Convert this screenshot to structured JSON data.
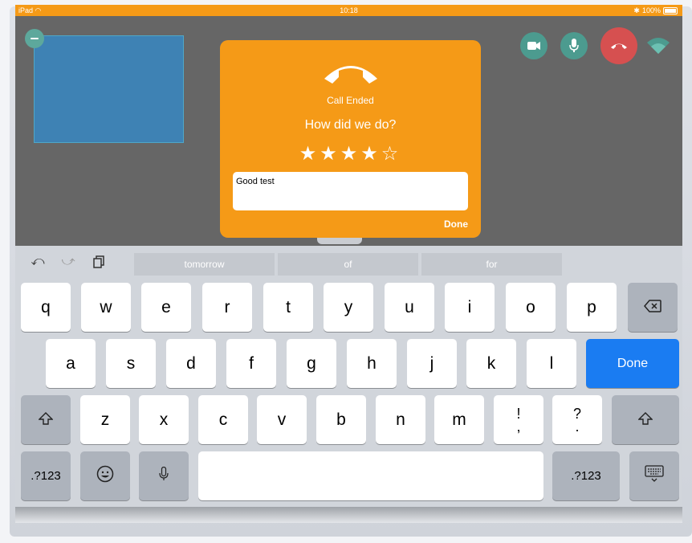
{
  "status_bar": {
    "left": "iPad",
    "time": "10:18",
    "battery": "100%"
  },
  "dialog": {
    "status": "Call Ended",
    "prompt": "How did we do?",
    "rating": 4,
    "rating_max": 5,
    "stars": "★★★★☆",
    "feedback": "Good test",
    "done": "Done"
  },
  "keyboard": {
    "suggestions": [
      "tomorrow",
      "of",
      "for"
    ],
    "row1": [
      "q",
      "w",
      "e",
      "r",
      "t",
      "y",
      "u",
      "i",
      "o",
      "p"
    ],
    "row2": [
      "a",
      "s",
      "d",
      "f",
      "g",
      "h",
      "j",
      "k",
      "l"
    ],
    "row3": [
      "z",
      "x",
      "c",
      "v",
      "b",
      "n",
      "m"
    ],
    "punct1": {
      "top": "!",
      "bottom": ","
    },
    "punct2": {
      "top": "?",
      "bottom": "."
    },
    "done": "Done",
    "numbers_left": ".?123",
    "numbers_right": ".?123"
  },
  "colors": {
    "accent": "#f59a17",
    "call_control": "#4c9b8f",
    "hangup": "#d65050",
    "keyboard_done": "#1a7cf2"
  },
  "icons": [
    "minimize-icon",
    "video-camera-icon",
    "microphone-icon",
    "hang-up-icon",
    "wifi-icon",
    "phone-handset-icon",
    "undo-icon",
    "redo-icon",
    "paste-icon",
    "backspace-icon",
    "shift-icon",
    "emoji-icon",
    "dictation-icon",
    "keyboard-dismiss-icon"
  ]
}
